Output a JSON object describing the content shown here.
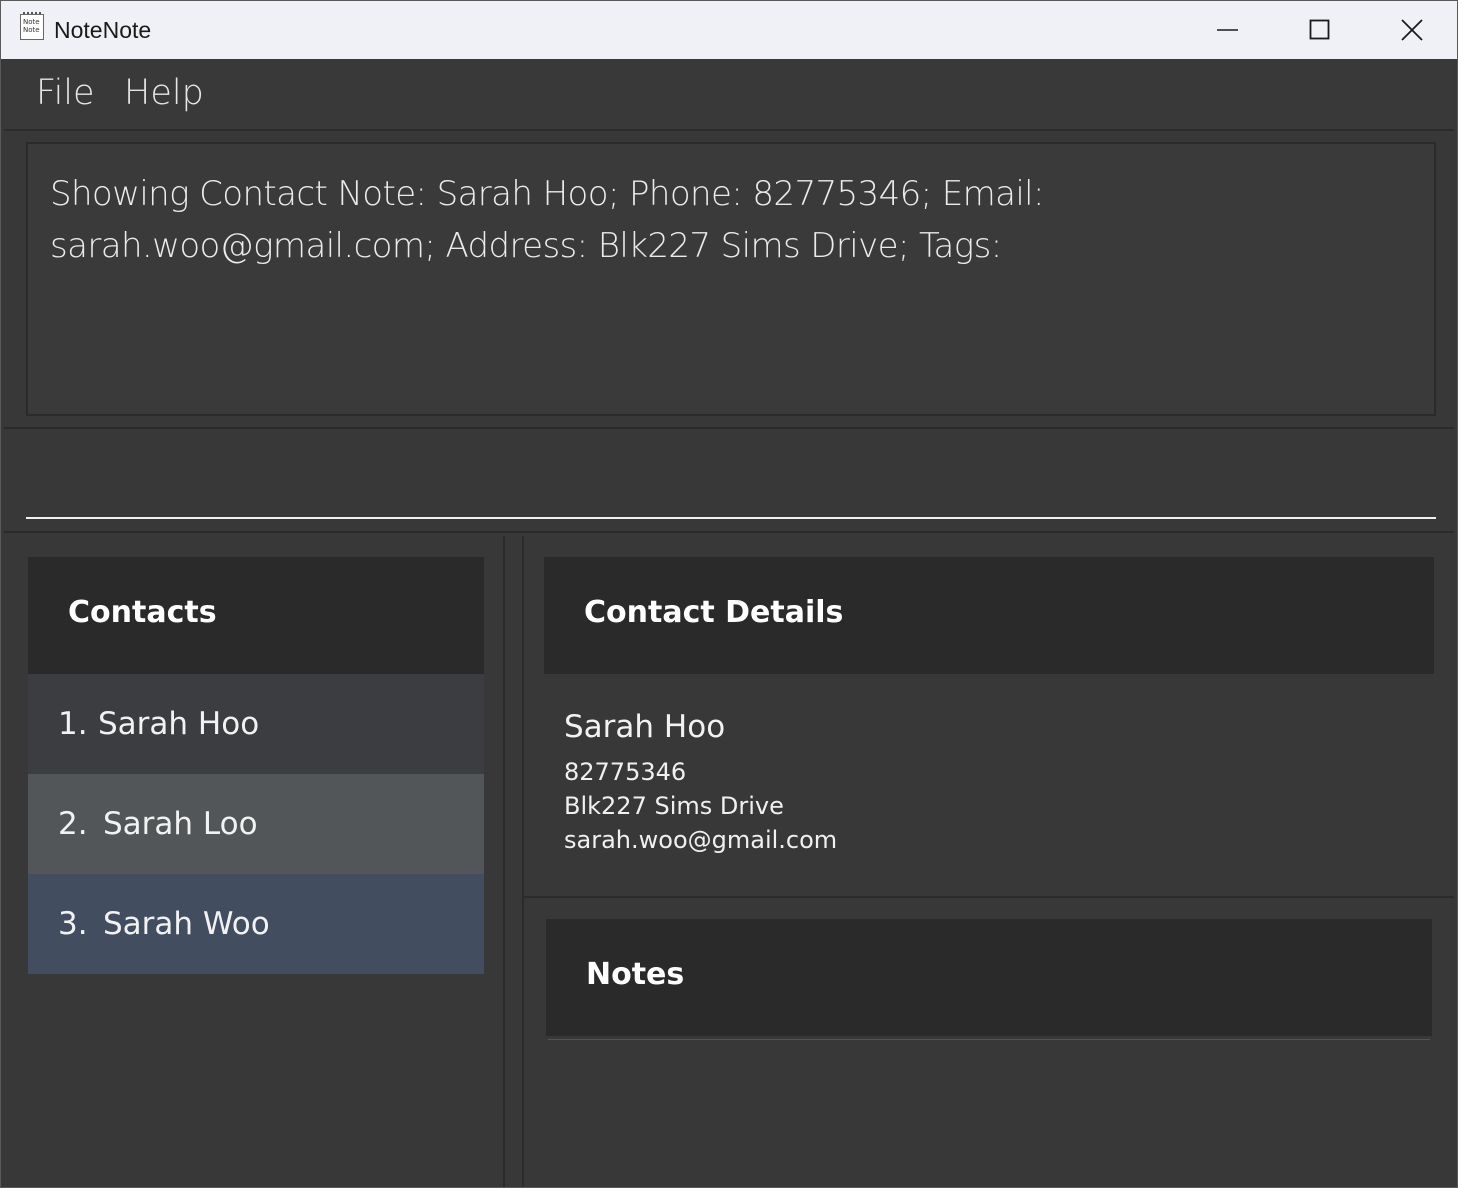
{
  "window": {
    "title": "NoteNote",
    "icon_label": "Note Note"
  },
  "menu": {
    "file": "File",
    "help": "Help"
  },
  "result": {
    "text": "Showing Contact Note: Sarah Hoo; Phone: 82775346; Email: sarah.woo@gmail.com; Address: Blk227 Sims Drive; Tags:"
  },
  "command": {
    "value": "",
    "placeholder": ""
  },
  "contacts": {
    "header": "Contacts",
    "items": [
      {
        "index": "1.",
        "name": "Sarah Hoo",
        "background": "#3c3d40"
      },
      {
        "index": "2.",
        "name": "Sarah Loo",
        "background": "#525659"
      },
      {
        "index": "3.",
        "name": "Sarah Woo",
        "background": "#424d60"
      }
    ]
  },
  "details": {
    "header": "Contact Details",
    "name": "Sarah Hoo",
    "phone": "82775346",
    "address": "Blk227 Sims Drive",
    "email": "sarah.woo@gmail.com"
  },
  "notes": {
    "header": "Notes",
    "content": ""
  },
  "icons": {
    "minimize": "minimize-icon",
    "maximize": "maximize-icon",
    "close": "close-icon",
    "app": "notenote-app-icon"
  }
}
